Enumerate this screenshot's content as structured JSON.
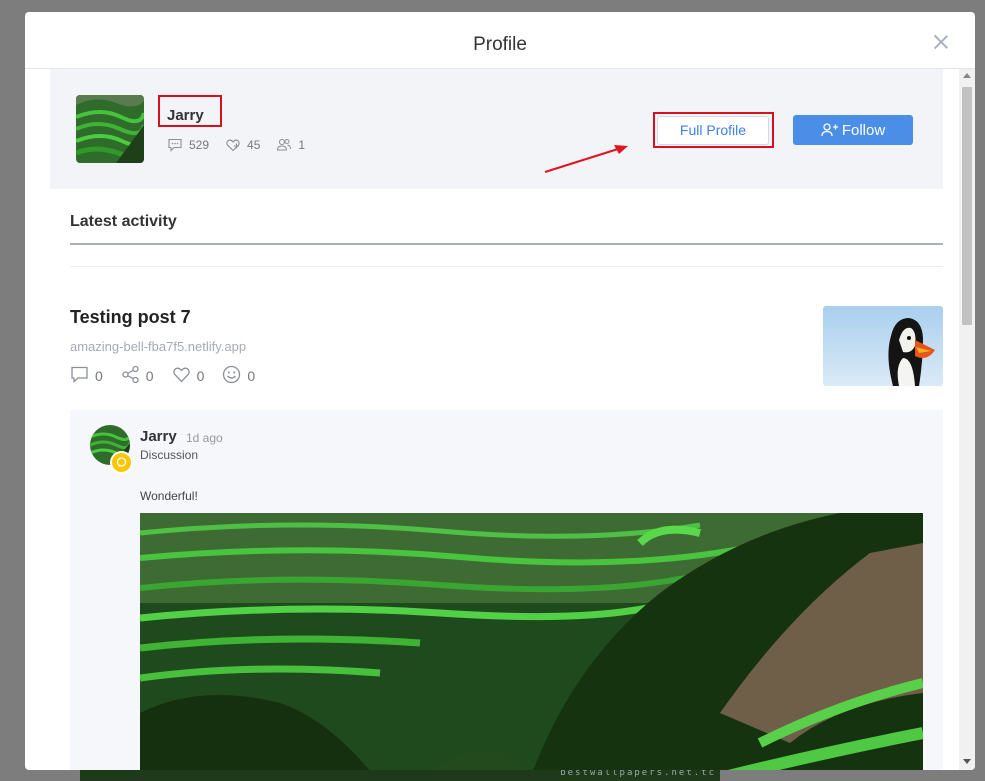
{
  "modal": {
    "title": "Profile"
  },
  "profile": {
    "name": "Jarry",
    "stats": [
      {
        "icon": "comment-icon",
        "value": "529"
      },
      {
        "icon": "heart-icon",
        "value": "45"
      },
      {
        "icon": "users-icon",
        "value": "1"
      }
    ],
    "full_profile_label": "Full Profile",
    "follow_label": "Follow"
  },
  "activity": {
    "section_title": "Latest activity",
    "post": {
      "title": "Testing post 7",
      "url": "amazing-bell-fba7f5.netlify.app",
      "comments": "0",
      "shares": "0",
      "likes": "0",
      "reactions": "0"
    },
    "comment": {
      "author": "Jarry",
      "time": "1d ago",
      "type": "Discussion",
      "text": "Wonderful!"
    }
  },
  "backdrop": {
    "watermark": "bestwallpapers.net.tc"
  },
  "colors": {
    "accent": "#4a8ee8",
    "highlight": "#d8101d",
    "badge": "#fbc500"
  }
}
